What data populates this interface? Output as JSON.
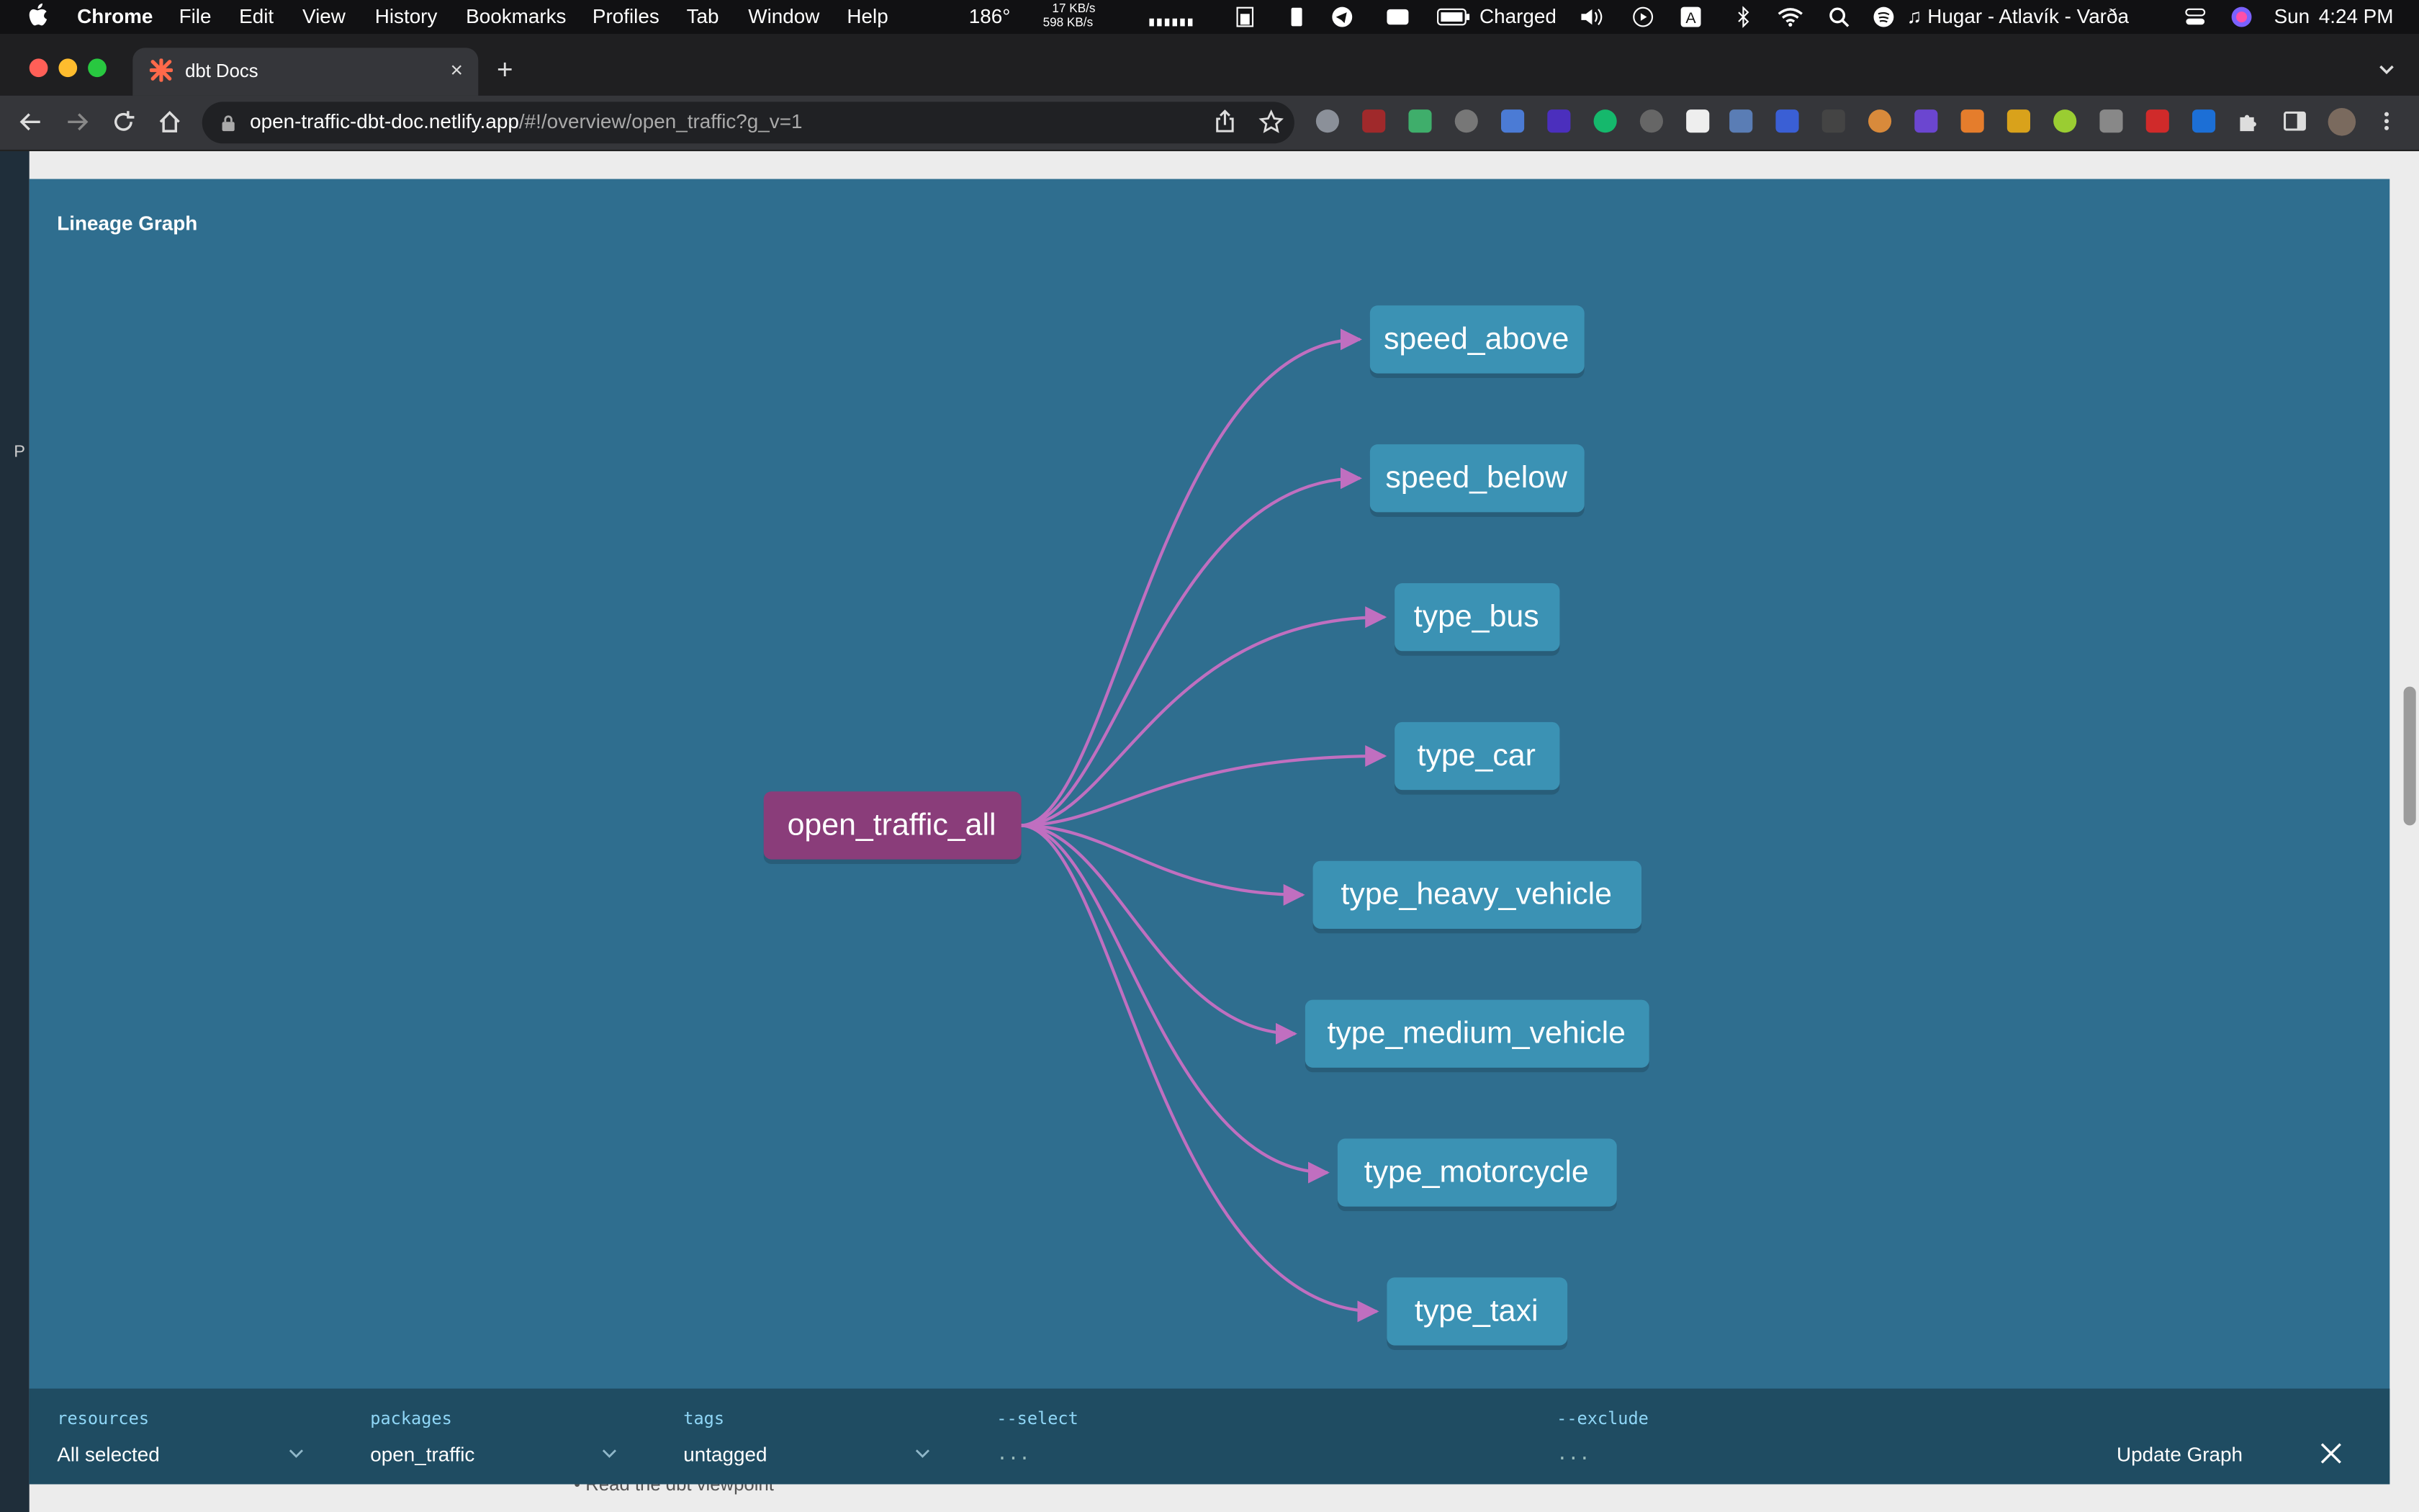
{
  "menubar": {
    "app_name": "Chrome",
    "items": [
      "File",
      "Edit",
      "View",
      "History",
      "Bookmarks",
      "Profiles",
      "Tab",
      "Window",
      "Help"
    ],
    "temp": "186°",
    "net_up": "17 KB/s",
    "net_down": "598 KB/s",
    "battery": "Charged",
    "now_playing": "Hugar - Atlavík - Varða",
    "day": "Sun",
    "time": "4:24 PM"
  },
  "browser": {
    "tab_title": "dbt Docs",
    "url_host": "open-traffic-dbt-doc.netlify.app",
    "url_path": "/#!/overview/open_traffic?g_v=1",
    "new_tab": "+",
    "tab_close": "×"
  },
  "page": {
    "left_edge_text": "P",
    "bottom_text": "• Read the dbt viewpoint"
  },
  "lineage": {
    "title": "Lineage Graph",
    "root": "open_traffic_all",
    "children": [
      "speed_above",
      "speed_below",
      "type_bus",
      "type_car",
      "type_heavy_vehicle",
      "type_medium_vehicle",
      "type_motorcycle",
      "type_taxi"
    ],
    "colors": {
      "root": "#8a3d7a",
      "child": "#3b92b4",
      "edge": "#c06fc0",
      "background": "#2f6e8f"
    }
  },
  "controls": {
    "resources_label": "resources",
    "resources_value": "All selected",
    "packages_label": "packages",
    "packages_value": "open_traffic",
    "tags_label": "tags",
    "tags_value": "untagged",
    "select_label": "--select",
    "select_placeholder": "...",
    "exclude_label": "--exclude",
    "exclude_placeholder": "...",
    "update_label": "Update Graph"
  }
}
